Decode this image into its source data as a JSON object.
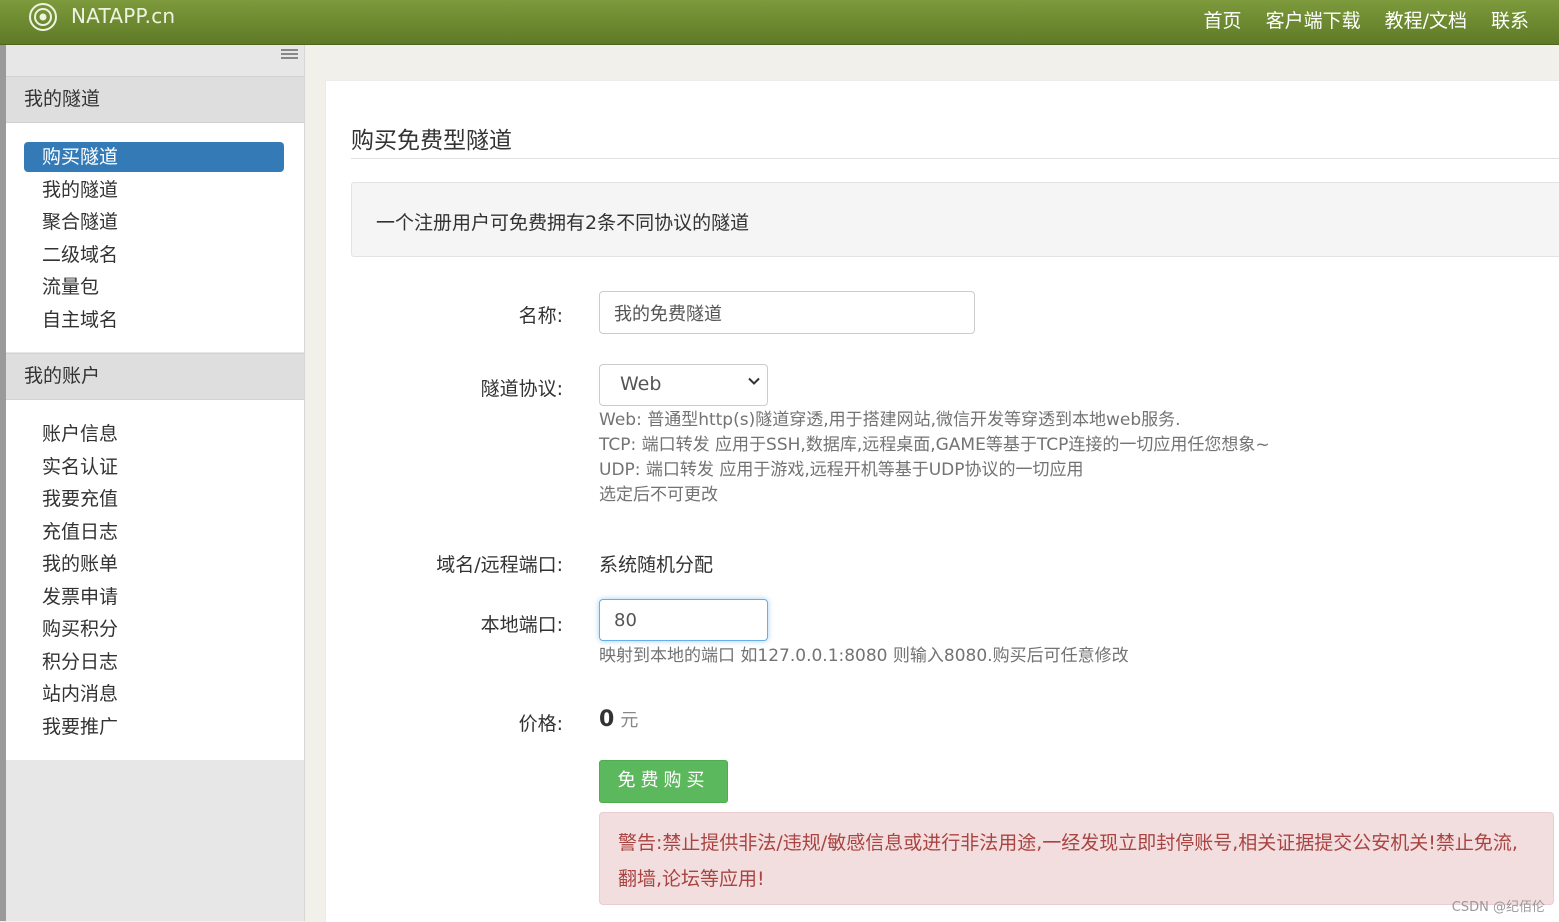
{
  "navbar": {
    "brand": "NATAPP.cn",
    "links": [
      "首页",
      "客户端下载",
      "教程/文档",
      "联系"
    ]
  },
  "sidebar": {
    "sections": [
      {
        "title": "我的隧道",
        "items": [
          "购买隧道",
          "我的隧道",
          "聚合隧道",
          "二级域名",
          "流量包",
          "自主域名"
        ],
        "active_index": 0
      },
      {
        "title": "我的账户",
        "items": [
          "账户信息",
          "实名认证",
          "我要充值",
          "充值日志",
          "我的账单",
          "发票申请",
          "购买积分",
          "积分日志",
          "站内消息",
          "我要推广"
        ]
      }
    ]
  },
  "main": {
    "title": "购买免费型隧道",
    "notice": "一个注册用户可免费拥有2条不同协议的隧道",
    "form": {
      "name_label": "名称:",
      "name_value": "我的免费隧道",
      "protocol_label": "隧道协议:",
      "protocol_value": "Web",
      "protocol_help": [
        "Web: 普通型http(s)隧道穿透,用于搭建网站,微信开发等穿透到本地web服务.",
        "TCP: 端口转发 应用于SSH,数据库,远程桌面,GAME等基于TCP连接的一切应用任您想象~",
        "UDP: 端口转发 应用于游戏,远程开机等基于UDP协议的一切应用",
        "选定后不可更改"
      ],
      "domain_label": "域名/远程端口:",
      "domain_value": "系统随机分配",
      "local_port_label": "本地端口:",
      "local_port_value": "80",
      "local_port_help": "映射到本地的端口 如127.0.0.1:8080 则输入8080.购买后可任意修改",
      "price_label": "价格:",
      "price_value": "0",
      "price_unit": "元",
      "buy_button": "免费购买",
      "warning": "警告:禁止提供非法/违规/敏感信息或进行非法用途,一经发现立即封停账号,相关证据提交公安机关!禁止免流,翻墙,论坛等应用!"
    }
  },
  "watermark": "CSDN @纪佰伦",
  "colors": {
    "navbar": "#6b8a2f",
    "active_menu": "#337ab7",
    "buy_button": "#5cb85c",
    "warning_bg": "#f2dede",
    "warning_text": "#a94442"
  }
}
